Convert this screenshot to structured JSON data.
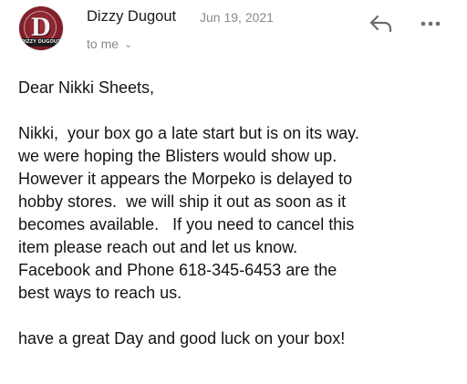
{
  "header": {
    "avatar_text": "D",
    "avatar_band_text": "DIZZY DUGOUT",
    "sender": "Dizzy Dugout",
    "date": "Jun 19, 2021",
    "recipient": "to me",
    "chevron": "⌄",
    "reply_icon": "reply-icon",
    "more_icon": "more-icon"
  },
  "message": {
    "greeting": "Dear Nikki Sheets,",
    "lines": [
      "Nikki,  your box go a late start but is on its way.",
      "we were hoping the Blisters would show up.",
      "However it appears the Morpeko is delayed to",
      "hobby stores.  we will ship it out as soon as it",
      "becomes available.   If you need to cancel this",
      "item please reach out and let us know.",
      "Facebook and Phone 618-345-6453 are the",
      "best ways to reach us."
    ],
    "closing": "have a great Day and good luck on your box!"
  }
}
